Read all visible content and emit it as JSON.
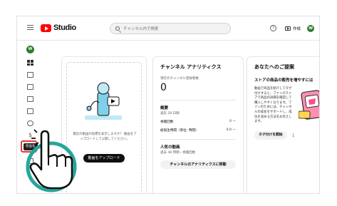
{
  "app": {
    "logo_text": "Studio",
    "brand_color": "#ff0000"
  },
  "header": {
    "search_placeholder": "チャンネル内で検索",
    "create_label": "作成",
    "avatar_letter": "W",
    "icons": [
      "menu-icon",
      "help-icon",
      "create-video-icon"
    ]
  },
  "sidebar": {
    "avatar_letter": "W",
    "items": [
      "dashboard",
      "content",
      "analytics",
      "comments",
      "subtitles",
      "copyright",
      "earn",
      "customization",
      "audio-library"
    ],
    "tooltip": "収益化",
    "highlight_color": "#e53935"
  },
  "upload_card": {
    "message": "最近の動画の指標を表示しますか？ 動画をアップロードして公開してください。",
    "button_label": "動画をアップロード"
  },
  "analytics_card": {
    "title": "チャンネル アナリティクス",
    "subscribers_label": "現在のチャンネル登録者数",
    "subscribers_value": "0",
    "summary_title": "概要",
    "summary_period": "過去 28 日間",
    "views_label": "視聴回数",
    "views_value": "0 —",
    "watch_time_label": "総再生時間（単位: 時間）",
    "watch_time_value": "0.0 —",
    "top_videos_title": "人気の動画",
    "top_videos_period": "過去 48 時間・視聴回数",
    "button_label": "チャンネルのアナリティクスに移動"
  },
  "ideas_card": {
    "title": "あなたへのご提案",
    "subtitle": "ストアの商品の販売を増やすには",
    "body": "動画で商品を紹介してタグ付けすると、ファンがストアで商品の詳細を確認して購入しやすくなります。ファンのためには、チャンネルの成長をサポートし、成功を収める方法をお伝えします。",
    "button_label": "タグ付けを開始"
  }
}
